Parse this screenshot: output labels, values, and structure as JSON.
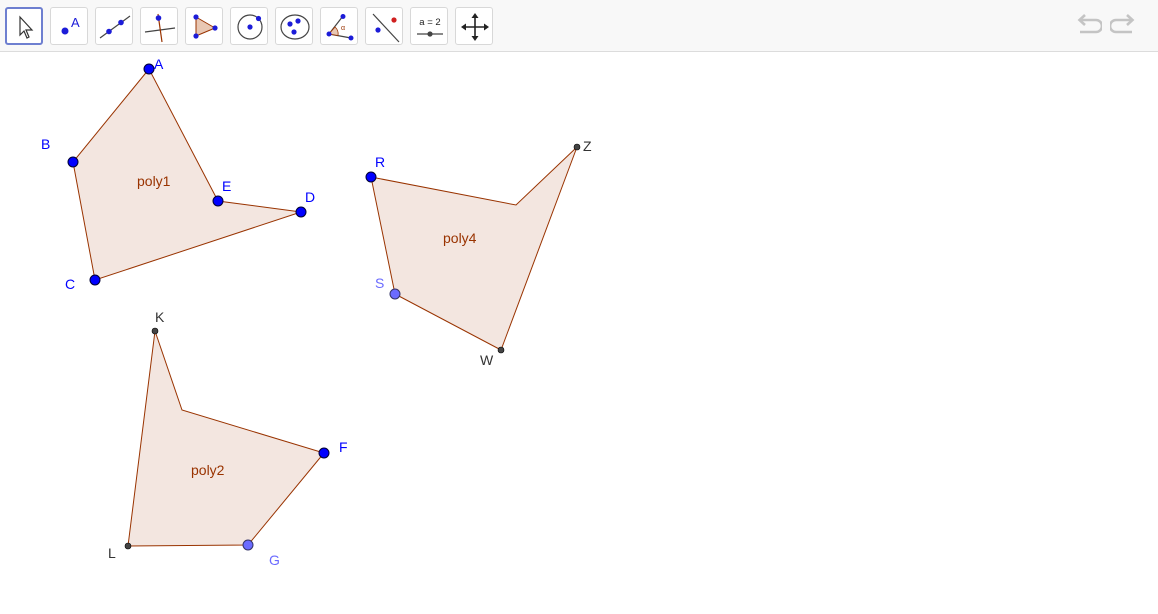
{
  "toolbar": {
    "tools": [
      {
        "name": "move-tool-icon"
      },
      {
        "name": "point-tool-icon",
        "glyph_text": "A"
      },
      {
        "name": "line-tool-icon"
      },
      {
        "name": "perpendicular-line-tool-icon"
      },
      {
        "name": "polygon-tool-icon"
      },
      {
        "name": "circle-tool-icon"
      },
      {
        "name": "conic-tool-icon"
      },
      {
        "name": "angle-tool-icon"
      },
      {
        "name": "reflect-tool-icon"
      },
      {
        "name": "slider-tool-icon",
        "glyph_text": "a = 2"
      },
      {
        "name": "move-graphics-view-tool-icon"
      }
    ],
    "active_tool": "move-tool-icon",
    "undo_icon": "undo-icon",
    "redo_icon": "redo-icon"
  },
  "colors": {
    "free_point": "#0000ff",
    "dependent_point": "#6b6bff",
    "fixed_point": "#444444",
    "polygon_fill": "#f3e6e0",
    "polygon_stroke": "#993300",
    "label_blue": "#0000ff",
    "label_light_blue": "#6b6bff",
    "label_dark": "#333333"
  },
  "polygons": {
    "poly1": {
      "label": "poly1"
    },
    "poly2": {
      "label": "poly2"
    },
    "poly4": {
      "label": "poly4"
    }
  },
  "points": {
    "A": "A",
    "B": "B",
    "C": "C",
    "D": "D",
    "E": "E",
    "K": "K",
    "F": "F",
    "G": "G",
    "L": "L",
    "R": "R",
    "Z": "Z",
    "W": "W",
    "S": "S"
  }
}
